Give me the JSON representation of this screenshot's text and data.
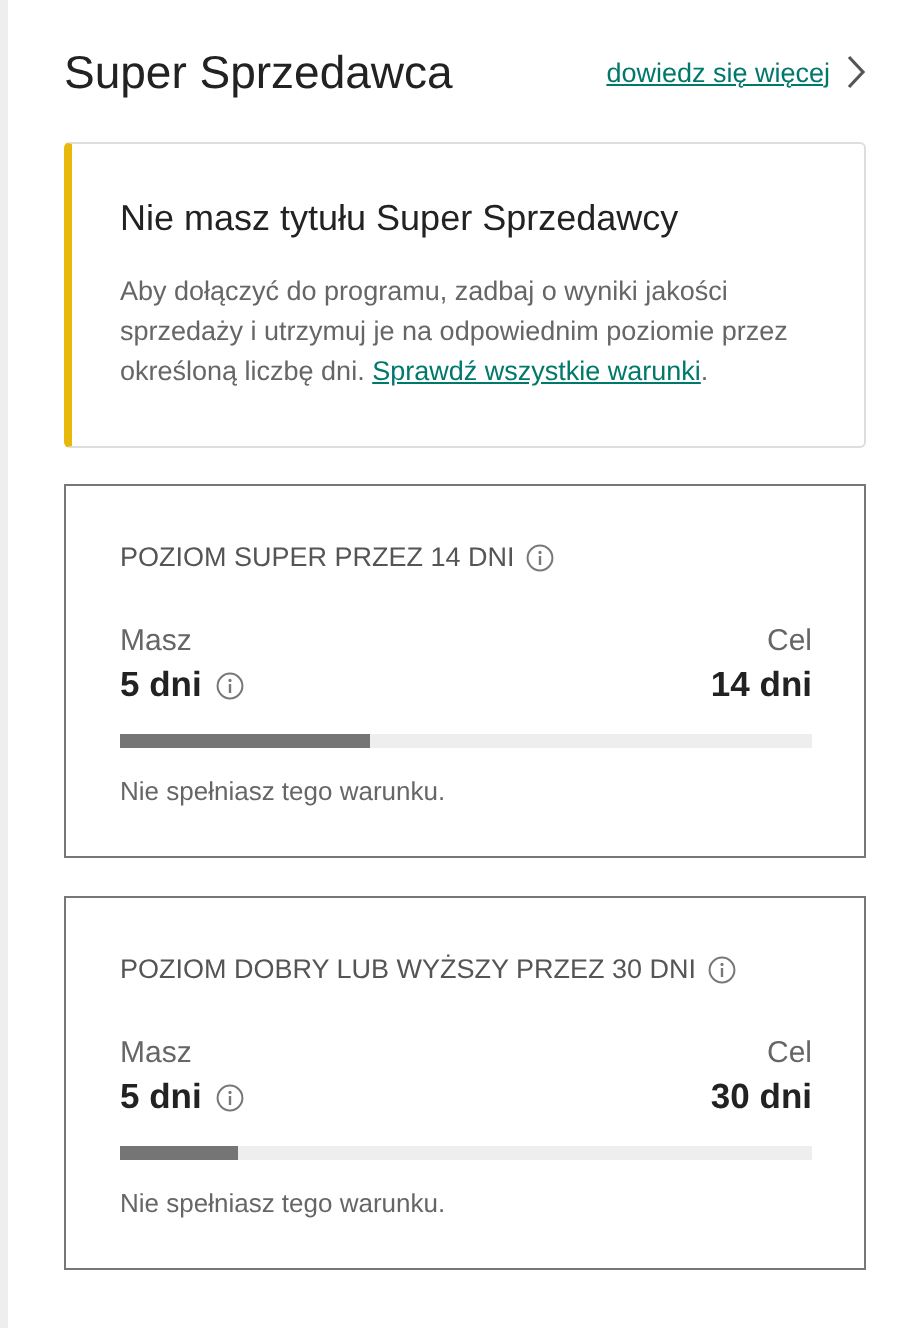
{
  "header": {
    "title": "Super Sprzedawca",
    "link": "dowiedz się więcej"
  },
  "notice": {
    "title": "Nie masz tytułu Super Sprzedawcy",
    "text": "Aby dołączyć do programu, zadbaj o wyniki jakości sprzedaży i utrzymuj je na odpowiednim poziomie przez określoną liczbę dni.",
    "link": "Sprawdź wszystkie warunki",
    "after": "."
  },
  "conditions": [
    {
      "title": "POZIOM SUPER PRZEZ 14 DNI",
      "have_label": "Masz",
      "have": "5 dni",
      "goal_label": "Cel",
      "goal": "14 dni",
      "level": 0.36,
      "status": "Nie spełniasz tego warunku."
    },
    {
      "title": "POZIOM DOBRY LUB WYŻSZY PRZEZ 30 DNI",
      "have_label": "Masz",
      "have": "5 dni",
      "goal_label": "Cel",
      "goal": "30 dni",
      "level": 0.17,
      "status": "Nie spełniasz tego warunku."
    }
  ]
}
